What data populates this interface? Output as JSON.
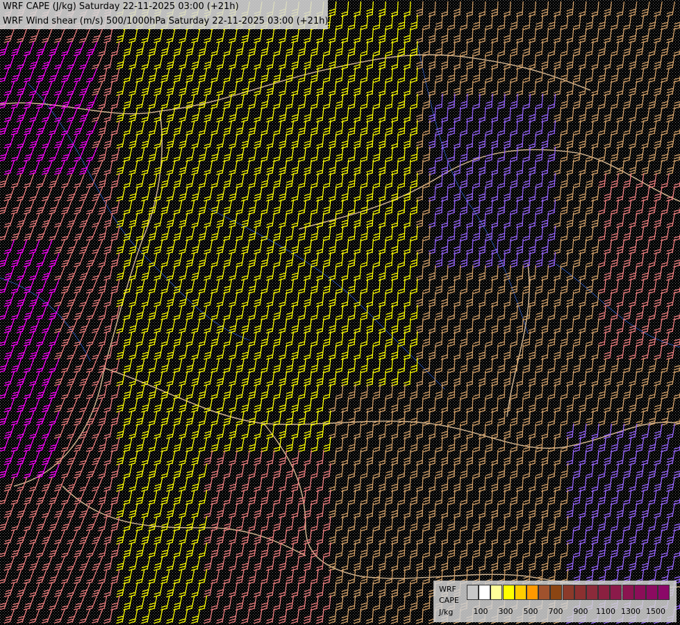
{
  "titles": {
    "line1": "WRF CAPE (J/kg) Saturday 22-11-2025 03:00 (+21h)",
    "line2": "WRF Wind shear (m/s) 500/1000hPa Saturday 22-11-2025 03:00 (+21h)"
  },
  "legend": {
    "model": "WRF",
    "variable": "CAPE",
    "unit": "J/kg",
    "tick_labels": [
      "100",
      "300",
      "500",
      "700",
      "900",
      "1100",
      "1300",
      "1500"
    ],
    "colors": [
      "#c8c8c8",
      "#ffffff",
      "#ffff99",
      "#ffff00",
      "#ffcc00",
      "#ff9900",
      "#a0522d",
      "#8b4513",
      "#8b3a2a",
      "#8b3030",
      "#8b2a3a",
      "#8b2040",
      "#8b1a4a",
      "#8b1450",
      "#8b0e58",
      "#8b0a60",
      "#8b0868"
    ]
  },
  "chart_data": {
    "type": "map",
    "layers": [
      "CAPE (J/kg)",
      "Wind shear 500/1000hPa (m/s) barbs"
    ],
    "barb_colors": {
      "low": "#d4a26a",
      "mid": "#ffff00",
      "high": "#f08080",
      "very_high": "#ff00ff",
      "extreme": "#9966ff"
    }
  }
}
